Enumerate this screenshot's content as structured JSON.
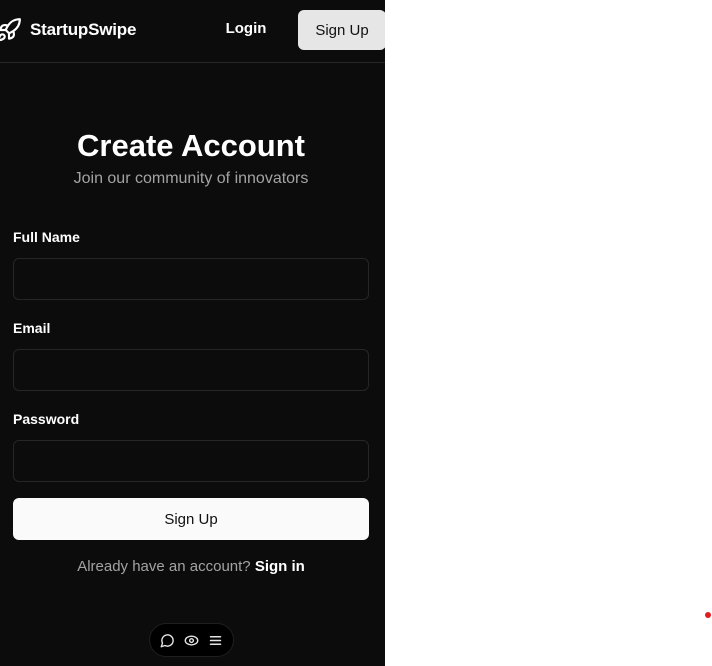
{
  "header": {
    "brand_name": "StartupSwipe",
    "brand_icon": "rocket-icon",
    "login_label": "Login",
    "signup_label": "Sign Up"
  },
  "form": {
    "title": "Create Account",
    "subtitle": "Join our community of innovators",
    "fields": [
      {
        "label": "Full Name",
        "value": "",
        "placeholder": ""
      },
      {
        "label": "Email",
        "value": "",
        "placeholder": ""
      },
      {
        "label": "Password",
        "value": "",
        "placeholder": ""
      }
    ],
    "submit_label": "Sign Up",
    "footer_prompt": "Already have an account?",
    "footer_link": "Sign in"
  },
  "toolbar": {
    "icons": [
      "chat-bubble-icon",
      "eye-icon",
      "menu-icon"
    ]
  },
  "colors": {
    "panel_background": "#0c0c0c",
    "page_background": "#ffffff",
    "primary_button": "#fafafa",
    "muted_text": "#a3a3a3",
    "indicator": "#e11d1d"
  }
}
